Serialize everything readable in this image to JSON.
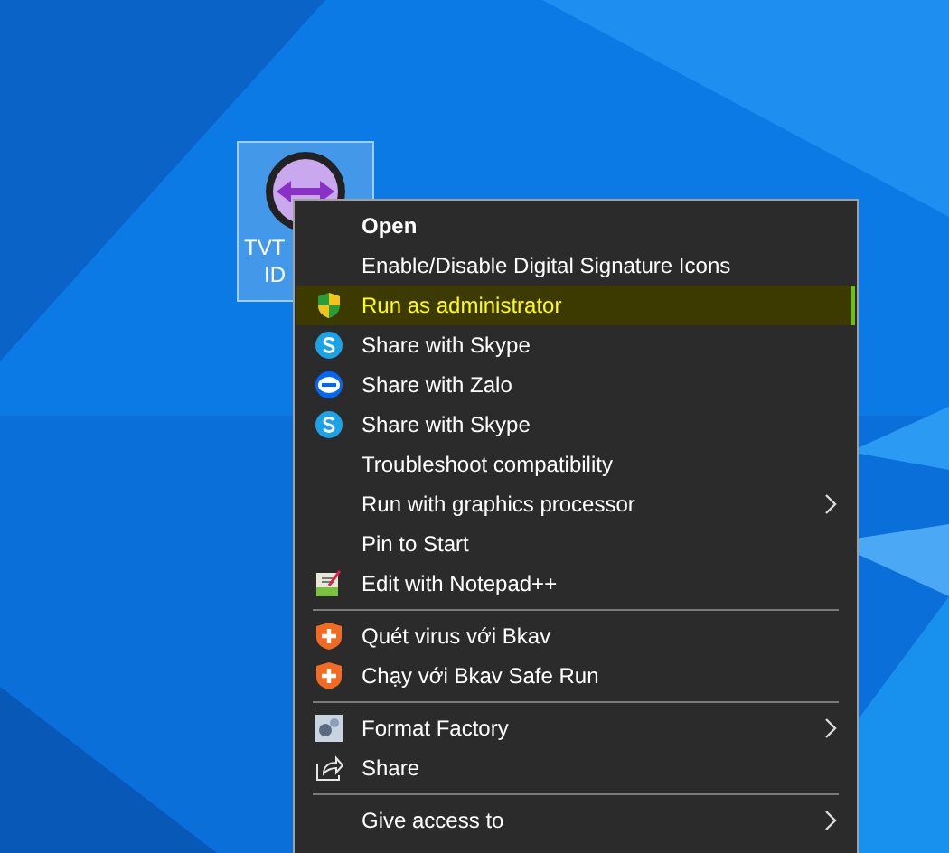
{
  "desktop_icon": {
    "label_lines": [
      "TVT",
      "ID"
    ],
    "selected": true
  },
  "context_menu": {
    "items": [
      {
        "kind": "plain",
        "label": "Open",
        "bold": true,
        "selected": false
      },
      {
        "kind": "plain",
        "label": "Enable/Disable Digital Signature Icons",
        "selected": false
      },
      {
        "kind": "shield",
        "label": "Run as administrator",
        "selected": true
      },
      {
        "kind": "skype",
        "label": "Share with Skype",
        "selected": false
      },
      {
        "kind": "zalo",
        "label": "Share with Zalo",
        "selected": false
      },
      {
        "kind": "skype",
        "label": "Share with Skype",
        "selected": false
      },
      {
        "kind": "plain",
        "label": "Troubleshoot compatibility",
        "selected": false
      },
      {
        "kind": "plain",
        "label": "Run with graphics processor",
        "submenu": true,
        "selected": false
      },
      {
        "kind": "plain",
        "label": "Pin to Start",
        "selected": false
      },
      {
        "kind": "notepad",
        "label": "Edit with Notepad++",
        "selected": false
      },
      {
        "kind": "separator"
      },
      {
        "kind": "bkav",
        "label": "Quét virus với Bkav",
        "selected": false
      },
      {
        "kind": "bkav",
        "label": "Chạy với Bkav Safe Run",
        "selected": false
      },
      {
        "kind": "separator"
      },
      {
        "kind": "format",
        "label": "Format Factory",
        "submenu": true,
        "selected": false
      },
      {
        "kind": "share",
        "label": "Share",
        "selected": false
      },
      {
        "kind": "separator"
      },
      {
        "kind": "plain",
        "label": "Give access to",
        "submenu": true,
        "selected": false
      }
    ]
  }
}
